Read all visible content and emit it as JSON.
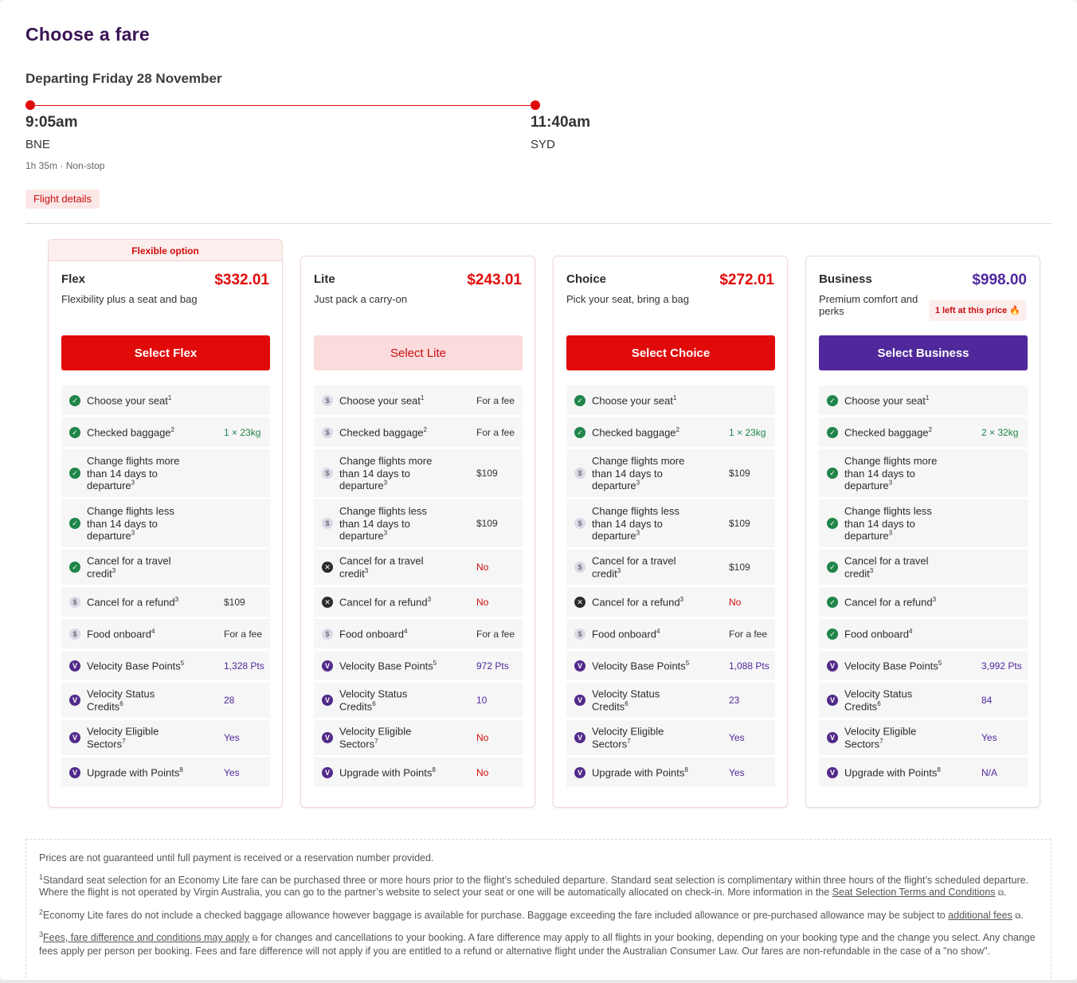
{
  "header": {
    "title": "Choose a fare",
    "departing": "Departing Friday 28 November"
  },
  "flight": {
    "depart_time": "9:05am",
    "depart_airport": "BNE",
    "arrive_time": "11:40am",
    "arrive_airport": "SYD",
    "duration": "1h 35m ·  Non-stop",
    "details_button": "Flight details"
  },
  "colors": {
    "brand_red": "#e10a0a",
    "brand_purple": "#50289c",
    "included_green": "#1f8549",
    "title_purple": "#3a1353"
  },
  "fares": [
    {
      "banner": "Flexible option",
      "name": "Flex",
      "price": "$332.01",
      "description": "Flexibility plus a seat and bag",
      "button": "Select Flex",
      "rows": [
        {
          "label": "Choose your seat",
          "sup": "1",
          "icon": "check",
          "value": ""
        },
        {
          "label": "Checked baggage",
          "sup": "2",
          "icon": "check",
          "value": "1 × 23kg"
        },
        {
          "label": "Change flights more than 14 days to departure",
          "sup": "3",
          "icon": "check",
          "value": ""
        },
        {
          "label": "Change flights less than 14 days to departure",
          "sup": "3",
          "icon": "check",
          "value": ""
        },
        {
          "label": "Cancel for a travel credit",
          "sup": "3",
          "icon": "check",
          "value": ""
        },
        {
          "label": "Cancel for a refund",
          "sup": "3",
          "icon": "dollar",
          "value": "$109"
        },
        {
          "label": "Food onboard",
          "sup": "4",
          "icon": "dollar",
          "value": "For a fee"
        },
        {
          "label": "Velocity Base Points",
          "sup": "5",
          "icon": "velocity",
          "value": "1,328 Pts"
        },
        {
          "label": "Velocity Status Credits",
          "sup": "6",
          "icon": "velocity",
          "value": "28"
        },
        {
          "label": "Velocity Eligible Sectors",
          "sup": "7",
          "icon": "velocity",
          "value": "Yes"
        },
        {
          "label": "Upgrade with Points",
          "sup": "8",
          "icon": "velocity",
          "value": "Yes"
        }
      ]
    },
    {
      "name": "Lite",
      "price": "$243.01",
      "description": "Just pack a carry-on",
      "button": "Select Lite",
      "rows": [
        {
          "label": "Choose your seat",
          "sup": "1",
          "icon": "dollar",
          "value": "For a fee"
        },
        {
          "label": "Checked baggage",
          "sup": "2",
          "icon": "dollar",
          "value": "For a fee"
        },
        {
          "label": "Change flights more than 14 days to departure",
          "sup": "3",
          "icon": "dollar",
          "value": "$109"
        },
        {
          "label": "Change flights less than 14 days to departure",
          "sup": "3",
          "icon": "dollar",
          "value": "$109"
        },
        {
          "label": "Cancel for a travel credit",
          "sup": "3",
          "icon": "cross",
          "value": "No"
        },
        {
          "label": "Cancel for a refund",
          "sup": "3",
          "icon": "cross",
          "value": "No"
        },
        {
          "label": "Food onboard",
          "sup": "4",
          "icon": "dollar",
          "value": "For a fee"
        },
        {
          "label": "Velocity Base Points",
          "sup": "5",
          "icon": "velocity",
          "value": "972 Pts"
        },
        {
          "label": "Velocity Status Credits",
          "sup": "6",
          "icon": "velocity",
          "value": "10"
        },
        {
          "label": "Velocity Eligible Sectors",
          "sup": "7",
          "icon": "velocity",
          "value": "No"
        },
        {
          "label": "Upgrade with Points",
          "sup": "8",
          "icon": "velocity",
          "value": "No"
        }
      ]
    },
    {
      "name": "Choice",
      "price": "$272.01",
      "description": "Pick your seat, bring a bag",
      "button": "Select Choice",
      "rows": [
        {
          "label": "Choose your seat",
          "sup": "1",
          "icon": "check",
          "value": ""
        },
        {
          "label": "Checked baggage",
          "sup": "2",
          "icon": "check",
          "value": "1 × 23kg"
        },
        {
          "label": "Change flights more than 14 days to departure",
          "sup": "3",
          "icon": "dollar",
          "value": "$109"
        },
        {
          "label": "Change flights less than 14 days to departure",
          "sup": "3",
          "icon": "dollar",
          "value": "$109"
        },
        {
          "label": "Cancel for a travel credit",
          "sup": "3",
          "icon": "dollar",
          "value": "$109"
        },
        {
          "label": "Cancel for a refund",
          "sup": "3",
          "icon": "cross",
          "value": "No"
        },
        {
          "label": "Food onboard",
          "sup": "4",
          "icon": "dollar",
          "value": "For a fee"
        },
        {
          "label": "Velocity Base Points",
          "sup": "5",
          "icon": "velocity",
          "value": "1,088 Pts"
        },
        {
          "label": "Velocity Status Credits",
          "sup": "6",
          "icon": "velocity",
          "value": "23"
        },
        {
          "label": "Velocity Eligible Sectors",
          "sup": "7",
          "icon": "velocity",
          "value": "Yes"
        },
        {
          "label": "Upgrade with Points",
          "sup": "8",
          "icon": "velocity",
          "value": "Yes"
        }
      ]
    },
    {
      "name": "Business",
      "price": "$998.00",
      "description": "Premium comfort and perks",
      "badge": "1 left at this price",
      "button": "Select Business",
      "rows": [
        {
          "label": "Choose your seat",
          "sup": "1",
          "icon": "check",
          "value": ""
        },
        {
          "label": "Checked baggage",
          "sup": "2",
          "icon": "check",
          "value": "2 × 32kg"
        },
        {
          "label": "Change flights more than 14 days to departure",
          "sup": "3",
          "icon": "check",
          "value": ""
        },
        {
          "label": "Change flights less than 14 days to departure",
          "sup": "3",
          "icon": "check",
          "value": ""
        },
        {
          "label": "Cancel for a travel credit",
          "sup": "3",
          "icon": "check",
          "value": ""
        },
        {
          "label": "Cancel for a refund",
          "sup": "3",
          "icon": "check",
          "value": ""
        },
        {
          "label": "Food onboard",
          "sup": "4",
          "icon": "check",
          "value": ""
        },
        {
          "label": "Velocity Base Points",
          "sup": "5",
          "icon": "velocity",
          "value": "3,992 Pts"
        },
        {
          "label": "Velocity Status Credits",
          "sup": "6",
          "icon": "velocity",
          "value": "84"
        },
        {
          "label": "Velocity Eligible Sectors",
          "sup": "7",
          "icon": "velocity",
          "value": "Yes"
        },
        {
          "label": "Upgrade with Points",
          "sup": "8",
          "icon": "velocity",
          "value": "N/A"
        }
      ]
    }
  ],
  "footnotes": {
    "disclaimer": "Prices are not guaranteed until full payment is received or a reservation number provided.",
    "note1_num": "1",
    "note1_text": "Standard seat selection for an Economy Lite fare can be purchased three or more hours prior to the flight’s scheduled departure. Standard seat selection is complimentary within three hours of the flight’s scheduled departure. Where the flight is not operated by Virgin Australia, you can go to the partner’s website to select your seat or one will be automatically allocated on check-in. More information in the ",
    "note1_link": "Seat Selection Terms and Conditions",
    "note2_num": "2",
    "note2_text": "Economy Lite fares do not include a checked baggage allowance however baggage is available for purchase. Baggage exceeding the fare included allowance or pre-purchased allowance may be subject to ",
    "note2_link": "additional fees",
    "note3_num": "3",
    "note3_link": "Fees, fare difference and conditions may apply",
    "note3_text": " for changes and cancellations to your booking. A fare difference may apply to all flights in your booking, depending on your booking type and the change you select. Any change fees apply per person per booking. Fees and fare difference will not apply if you are entitled to a refund or alternative flight under the Australian Consumer Law. Our fares are non-refundable in the case of a \"no show\"."
  }
}
